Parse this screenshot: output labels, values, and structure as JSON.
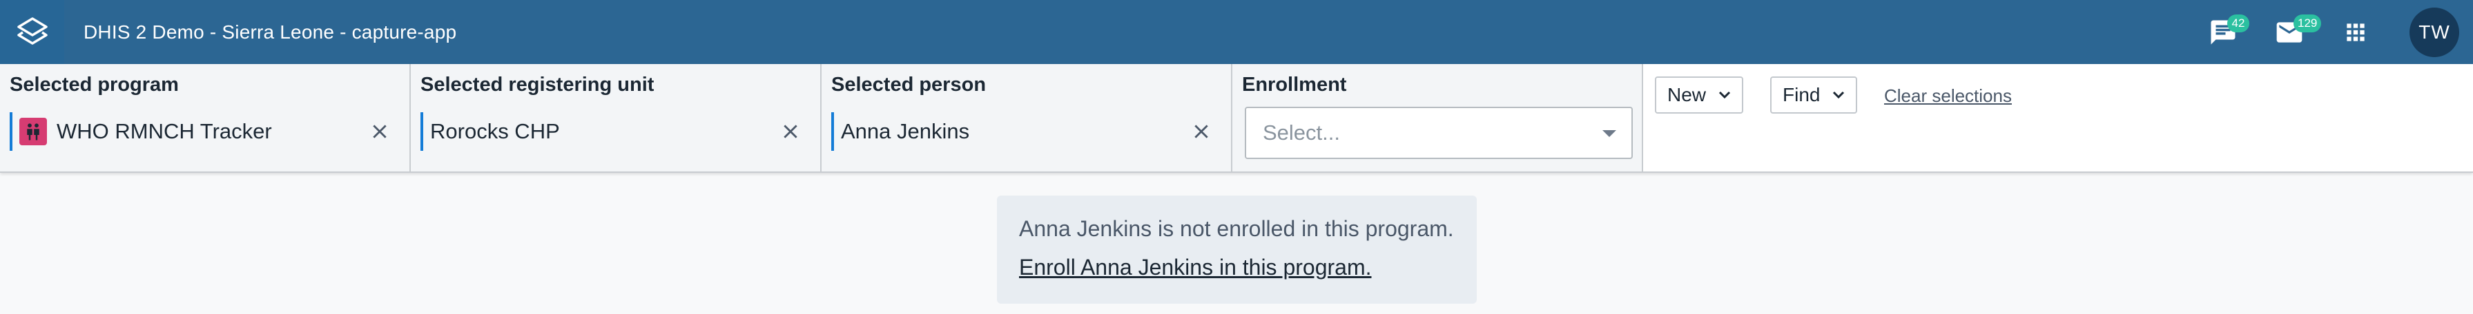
{
  "header": {
    "app_title": "DHIS 2 Demo - Sierra Leone - capture-app",
    "messages_badge": "42",
    "interpretations_badge": "129",
    "avatar_initials": "TW",
    "brand_color": "#2c6693"
  },
  "context": {
    "program": {
      "label": "Selected program",
      "value": "WHO RMNCH Tracker",
      "icon": "family-icon"
    },
    "org_unit": {
      "label": "Selected registering unit",
      "value": "Rorocks CHP"
    },
    "person": {
      "label": "Selected person",
      "value": "Anna Jenkins"
    },
    "enrollment": {
      "label": "Enrollment",
      "placeholder": "Select..."
    },
    "new_button": "New",
    "find_button": "Find",
    "clear_link": "Clear selections"
  },
  "message": {
    "text": "Anna Jenkins is not enrolled in this program.",
    "link": "Enroll Anna Jenkins in this program."
  }
}
